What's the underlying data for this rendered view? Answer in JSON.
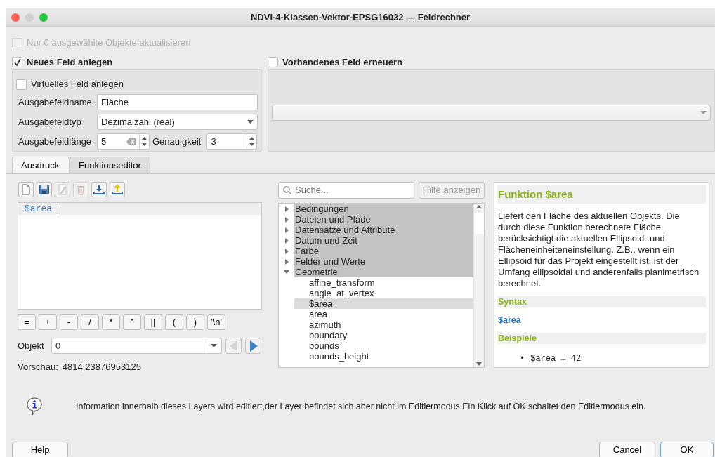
{
  "window": {
    "title": "NDVI-4-Klassen-Vektor-EPSG16032 — Feldrechner"
  },
  "update_selected_only": {
    "label": "Nur 0 ausgewählte Objekte aktualisieren",
    "checked": false,
    "disabled": true
  },
  "new_field": {
    "label": "Neues Feld anlegen",
    "checked": true,
    "virtual": {
      "label": "Virtuelles Feld anlegen",
      "checked": false
    },
    "name": {
      "label": "Ausgabefeldname",
      "value": "Fläche"
    },
    "type": {
      "label": "Ausgabefeldtyp",
      "value": "Dezimalzahl (real)"
    },
    "length": {
      "label": "Ausgabefeldlänge",
      "value": "5"
    },
    "precision": {
      "label": "Genauigkeit",
      "value": "3"
    }
  },
  "update_existing": {
    "label": "Vorhandenes Feld erneuern",
    "checked": false
  },
  "tabs": [
    {
      "label": "Ausdruck",
      "selected": true
    },
    {
      "label": "Funktionseditor",
      "selected": false
    }
  ],
  "expression": {
    "toolbar": [
      {
        "kind": "new",
        "disabled": false
      },
      {
        "kind": "save",
        "disabled": false
      },
      {
        "kind": "edit",
        "disabled": true
      },
      {
        "kind": "delete",
        "disabled": true
      },
      {
        "kind": "import",
        "disabled": false
      },
      {
        "kind": "export",
        "disabled": false
      }
    ],
    "text": "$area",
    "operators": [
      "=",
      "+",
      "-",
      "/",
      "*",
      "^",
      "||",
      "(",
      ")",
      "'\\n'"
    ],
    "object": {
      "label": "Objekt",
      "value": "0"
    },
    "preview": {
      "label": "Vorschau:",
      "value": "4814,23876953125"
    }
  },
  "functions": {
    "search": {
      "placeholder": "Suche..."
    },
    "help_button": "Hilfe anzeigen",
    "tree": [
      {
        "label": "Bedingungen",
        "expanded": false,
        "selected": false
      },
      {
        "label": "Dateien und Pfade",
        "expanded": false,
        "selected": false
      },
      {
        "label": "Datensätze und Attribute",
        "expanded": false,
        "selected": false
      },
      {
        "label": "Datum und Zeit",
        "expanded": false,
        "selected": false
      },
      {
        "label": "Farbe",
        "expanded": false,
        "selected": false
      },
      {
        "label": "Felder und Werte",
        "expanded": false,
        "selected": false
      },
      {
        "label": "Geometrie",
        "expanded": true,
        "selected": false,
        "children": [
          {
            "label": "affine_transform",
            "selected": false
          },
          {
            "label": "angle_at_vertex",
            "selected": false
          },
          {
            "label": "$area",
            "selected": true
          },
          {
            "label": "area",
            "selected": false
          },
          {
            "label": "azimuth",
            "selected": false
          },
          {
            "label": "boundary",
            "selected": false
          },
          {
            "label": "bounds",
            "selected": false
          },
          {
            "label": "bounds_height",
            "selected": false
          }
        ]
      }
    ]
  },
  "help": {
    "title": "Funktion $area",
    "description": "Liefert den Fläche des aktuellen Objekts. Die durch diese Funktion berechnete Fläche berücksichtigt die aktuellen Ellipsoid- und Flächeneinheiteneinstellung. Z.B., wenn ein Ellipsoid für das Projekt eingestellt ist, ist der Umfang ellipsoidal und anderenfalls planimetrisch berechnet.",
    "syntax_heading": "Syntax",
    "syntax": "$area",
    "examples_heading": "Beispiele",
    "examples": [
      {
        "marker": "•",
        "text": "$area → 42"
      }
    ]
  },
  "info": {
    "message": "Information innerhalb dieses Layers wird editiert,der Layer befindet sich aber nicht im Editiermodus.Ein Klick auf OK schaltet den Editiermodus ein."
  },
  "buttons": [
    {
      "label": "Help",
      "default": false
    },
    {
      "label": "Cancel",
      "default": false
    },
    {
      "label": "OK",
      "default": true
    }
  ]
}
